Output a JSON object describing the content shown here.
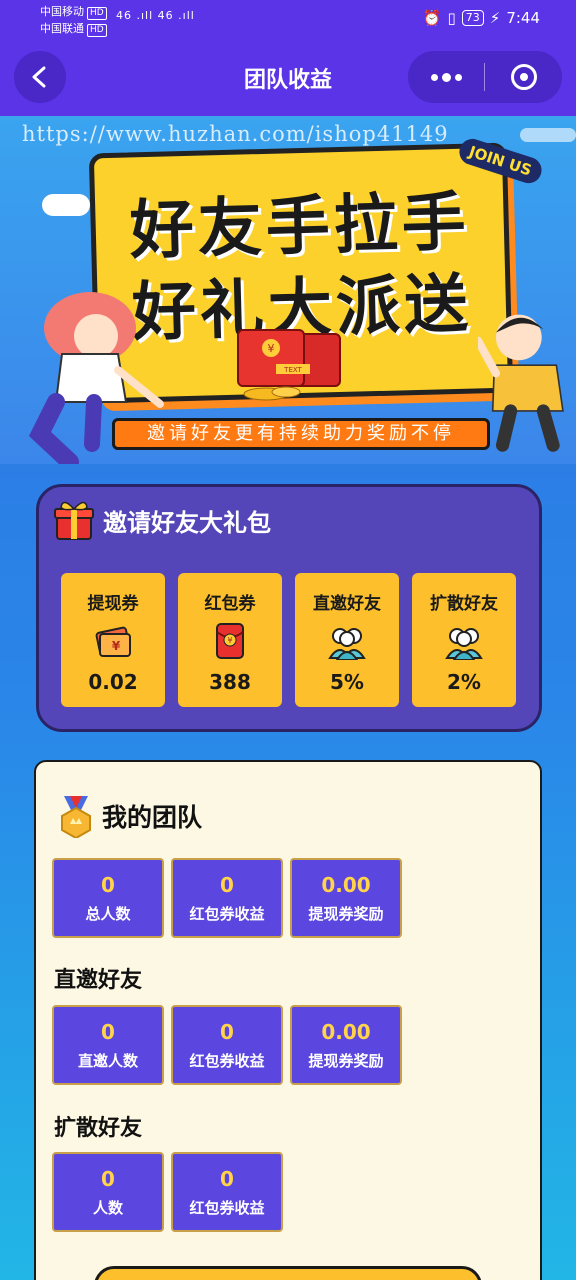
{
  "status_bar": {
    "carrier1": "中国移动",
    "carrier2": "中国联通",
    "hd": "HD",
    "signal": "46 .ıll 46 .ıll",
    "battery": "73",
    "time": "7:44"
  },
  "nav": {
    "title": "团队收益",
    "back_icon": "chevron-left-icon",
    "more_icon": "more-dots-icon",
    "close_icon": "target-circle-icon"
  },
  "banner": {
    "watermark": "https://www.huzhan.com/ishop41149",
    "headline1": "好友手拉手",
    "headline2": "好礼大派送",
    "badge": "JOIN US",
    "packet_label": "TEXT",
    "slogan": "邀请好友更有持续助力奖励不停"
  },
  "gift": {
    "title": "邀请好友大礼包",
    "items": [
      {
        "label": "提现券",
        "value": "0.02",
        "icon": "ticket-icon"
      },
      {
        "label": "红包券",
        "value": "388",
        "icon": "red-envelope-icon"
      },
      {
        "label": "直邀好友",
        "value": "5%",
        "icon": "friends-icon"
      },
      {
        "label": "扩散好友",
        "value": "2%",
        "icon": "friends-icon"
      }
    ]
  },
  "team": {
    "title": "我的团队",
    "total": [
      {
        "value": "0",
        "label": "总人数"
      },
      {
        "value": "0",
        "label": "红包券收益"
      },
      {
        "value": "0.00",
        "label": "提现券奖励"
      }
    ],
    "direct_title": "直邀好友",
    "direct": [
      {
        "value": "0",
        "label": "直邀人数"
      },
      {
        "value": "0",
        "label": "红包券收益"
      },
      {
        "value": "0.00",
        "label": "提现券奖励"
      }
    ],
    "spread_title": "扩散好友",
    "spread": [
      {
        "value": "0",
        "label": "人数"
      },
      {
        "value": "0",
        "label": "红包券收益"
      }
    ]
  },
  "colors": {
    "nav_purple": "#5a34e6",
    "gift_card": "#5446b8",
    "gold": "#fdc02c",
    "stat_purple": "#5b46e0",
    "stat_value": "#ffd34a"
  }
}
